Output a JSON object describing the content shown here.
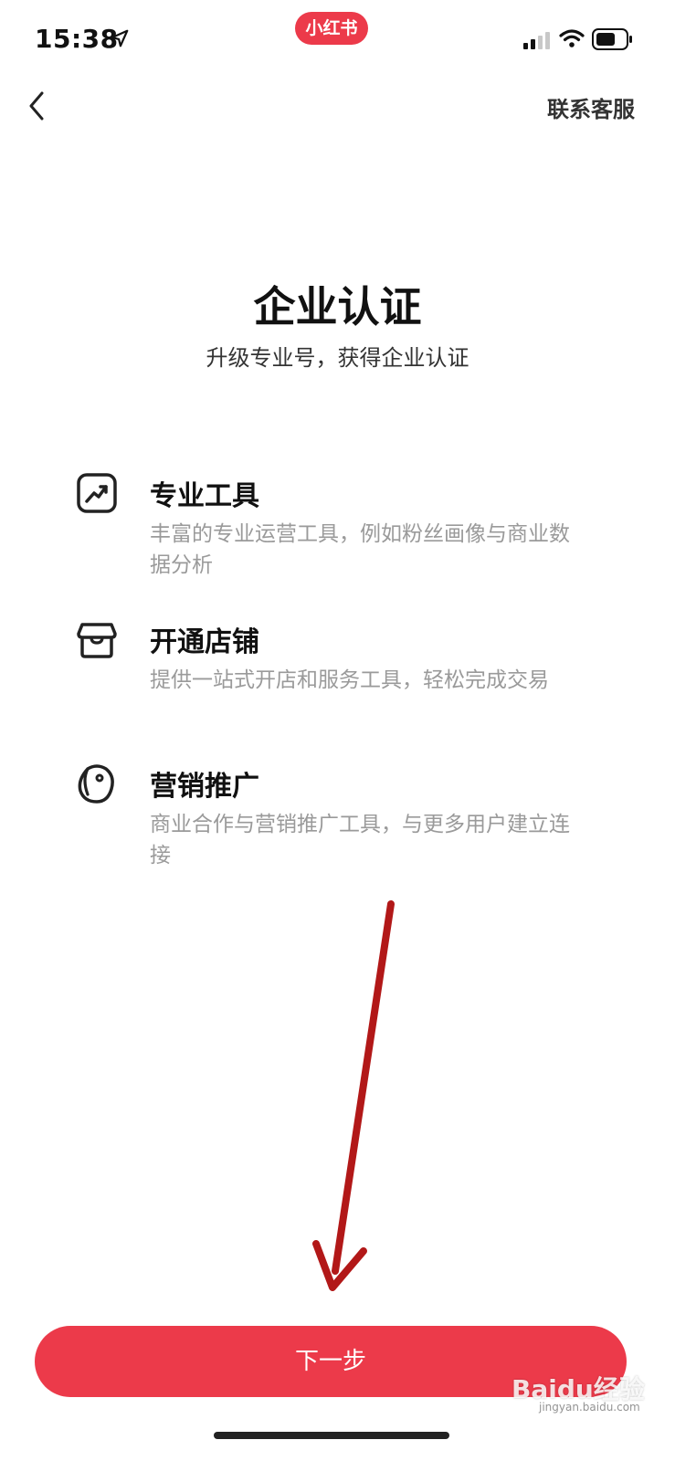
{
  "status_bar": {
    "time": "15:38",
    "app_badge": "小红书",
    "icons": [
      "location-arrow-icon",
      "cellular-signal-icon",
      "wifi-icon",
      "battery-icon"
    ]
  },
  "nav": {
    "back_icon": "chevron-left-icon",
    "contact_label": "联系客服"
  },
  "header": {
    "title": "企业认证",
    "subtitle": "升级专业号，获得企业认证"
  },
  "features": [
    {
      "icon": "trend-chart-icon",
      "title": "专业工具",
      "desc": "丰富的专业运营工具，例如粉丝画像与商业数据分析"
    },
    {
      "icon": "store-icon",
      "title": "开通店铺",
      "desc": "提供一站式开店和服务工具，轻松完成交易"
    },
    {
      "icon": "tag-icon",
      "title": "营销推广",
      "desc": "商业合作与营销推广工具，与更多用户建立连接"
    }
  ],
  "footer": {
    "next_label": "下一步"
  },
  "watermark": {
    "main": "Baidu经验",
    "sub": "jingyan.baidu.com"
  },
  "colors": {
    "accent": "#ec3a4a",
    "annotation_arrow": "#b21818",
    "desc_text": "#9a9a9a"
  }
}
